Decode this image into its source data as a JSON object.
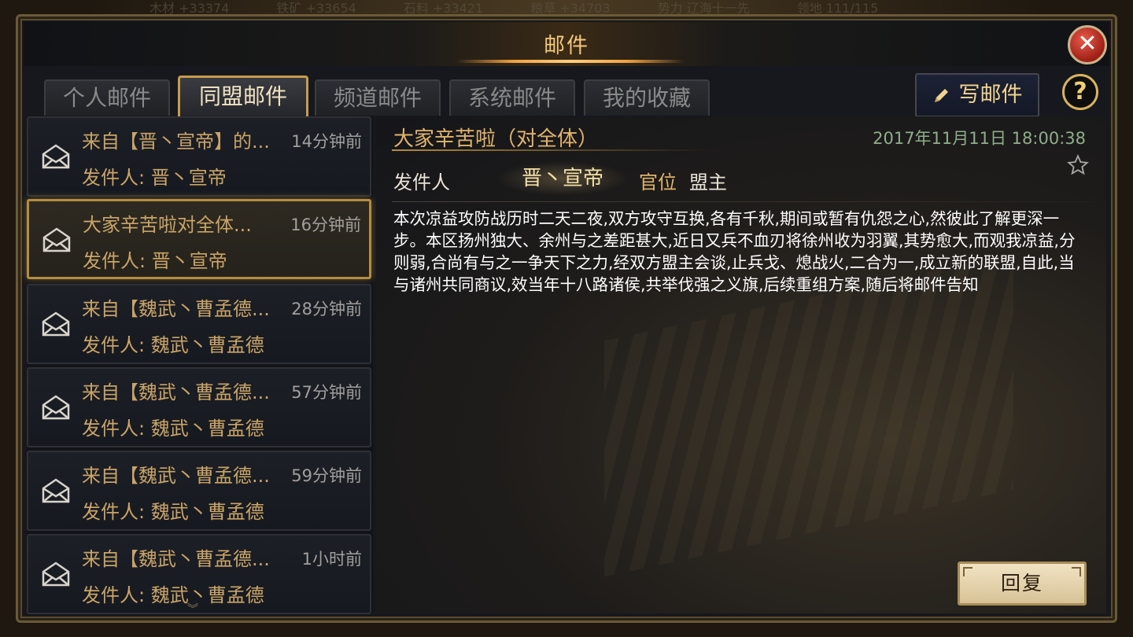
{
  "top_resources": [
    "木材 +33374",
    "铁矿 +33654",
    "石料 +33421",
    "粮草 +34703",
    "势力 辽海十一先",
    "领地 111/115"
  ],
  "header": {
    "title": "邮件"
  },
  "tabs": [
    {
      "label": "个人邮件",
      "active": false
    },
    {
      "label": "同盟邮件",
      "active": true
    },
    {
      "label": "频道邮件",
      "active": false
    },
    {
      "label": "系统邮件",
      "active": false
    },
    {
      "label": "我的收藏",
      "active": false
    }
  ],
  "toolbar": {
    "write_label": "写邮件",
    "help_symbol": "?",
    "close_symbol": "✕"
  },
  "mails": [
    {
      "subject": "来自【晋丶宣帝】的...",
      "time": "14分钟前",
      "sender_label": "发件人:",
      "sender": "晋丶宣帝",
      "selected": false
    },
    {
      "subject": "大家辛苦啦对全体...",
      "time": "16分钟前",
      "sender_label": "发件人:",
      "sender": "晋丶宣帝",
      "selected": true
    },
    {
      "subject": "来自【魏武丶曹孟德...",
      "time": "28分钟前",
      "sender_label": "发件人:",
      "sender": "魏武丶曹孟德",
      "selected": false
    },
    {
      "subject": "来自【魏武丶曹孟德...",
      "time": "57分钟前",
      "sender_label": "发件人:",
      "sender": "魏武丶曹孟德",
      "selected": false
    },
    {
      "subject": "来自【魏武丶曹孟德...",
      "time": "59分钟前",
      "sender_label": "发件人:",
      "sender": "魏武丶曹孟德",
      "selected": false
    },
    {
      "subject": "来自【魏武丶曹孟德...",
      "time": "1小时前",
      "sender_label": "发件人:",
      "sender": "魏武丶曹孟德",
      "selected": false
    }
  ],
  "detail": {
    "subject": "大家辛苦啦（对全体）",
    "date": "2017年11月11日 18:00:38",
    "from_label": "发件人",
    "from_name": "晋丶宣帝",
    "rank_label": "官位",
    "rank_value": "盟主",
    "body": "本次凉益攻防战历时二天二夜,双方攻守互换,各有千秋,期间或暂有仇怨之心,然彼此了解更深一步。本区扬州独大、余州与之差距甚大,近日又兵不血刃将徐州收为羽翼,其势愈大,而观我凉益,分则弱,合尚有与之一争天下之力,经双方盟主会谈,止兵戈、熄战火,二合为一,成立新的联盟,自此,当与诸州共同商议,效当年十八路诸侯,共举伐强之义旗,后续重组方案,随后将邮件告知",
    "reply_label": "回复"
  },
  "colors": {
    "accent": "#c79b4e",
    "subject_gold": "#e0b36c",
    "date_green": "#8fae8a"
  }
}
